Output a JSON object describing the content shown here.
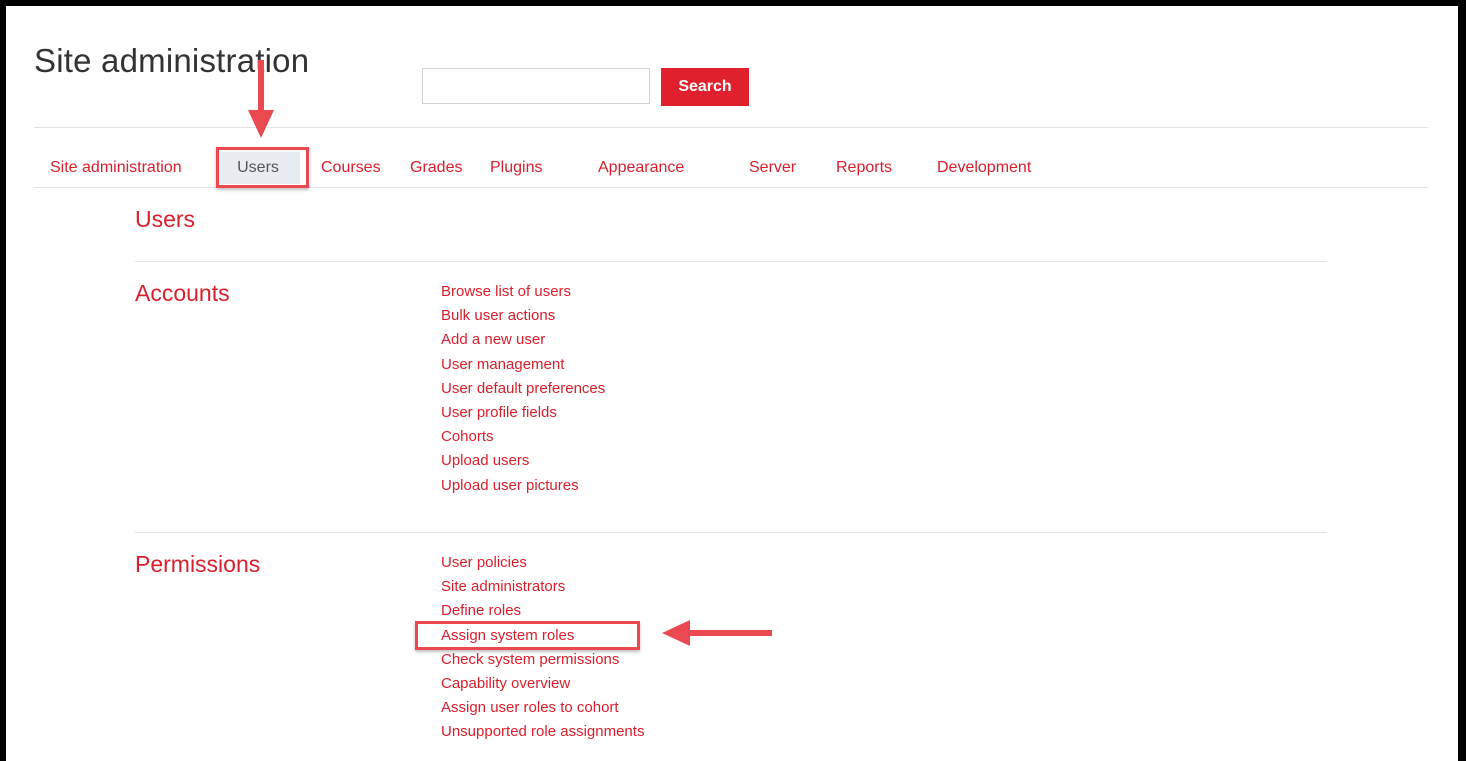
{
  "header": {
    "title": "Site administration",
    "search": {
      "value": "",
      "placeholder": "",
      "button_label": "Search"
    }
  },
  "tabs": [
    {
      "label": "Site administration",
      "active": false
    },
    {
      "label": "Users",
      "active": true
    },
    {
      "label": "Courses",
      "active": false
    },
    {
      "label": "Grades",
      "active": false
    },
    {
      "label": "Plugins",
      "active": false
    },
    {
      "label": "Appearance",
      "active": false
    },
    {
      "label": "Server",
      "active": false
    },
    {
      "label": "Reports",
      "active": false
    },
    {
      "label": "Development",
      "active": false
    }
  ],
  "main": {
    "heading": "Users",
    "sections": [
      {
        "title": "Accounts",
        "links": [
          "Browse list of users",
          "Bulk user actions",
          "Add a new user",
          "User management",
          "User default preferences",
          "User profile fields",
          "Cohorts",
          "Upload users",
          "Upload user pictures"
        ]
      },
      {
        "title": "Permissions",
        "links": [
          "User policies",
          "Site administrators",
          "Define roles",
          "Assign system roles",
          "Check system permissions",
          "Capability overview",
          "Assign user roles to cohort",
          "Unsupported role assignments"
        ]
      }
    ]
  },
  "annotations": {
    "color": "#ea4a4f",
    "highlighted_tab": "Users",
    "highlighted_link": "Assign system roles"
  },
  "colors": {
    "brand_red": "#e0202d",
    "link_red": "#d91f2b",
    "active_tab_bg": "#e8edf1"
  }
}
